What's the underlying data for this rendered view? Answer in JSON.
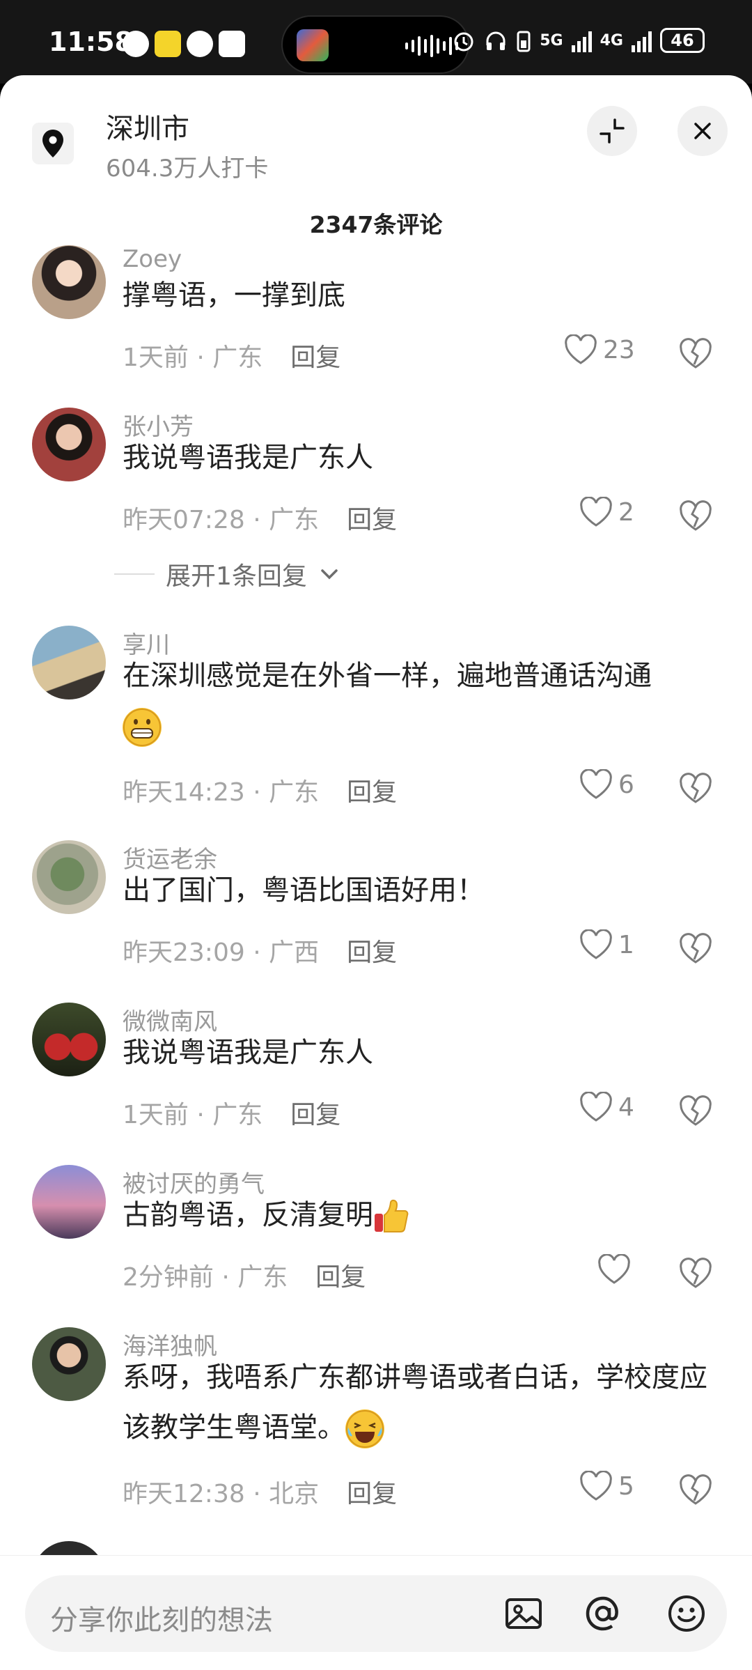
{
  "status_bar": {
    "time": "11:58",
    "battery": "46",
    "net1": "5G",
    "net2": "4G"
  },
  "location": {
    "title": "深圳市",
    "subtitle": "604.3万人打卡"
  },
  "comment_count": "2347条评论",
  "comments": [
    {
      "user": "Zoey",
      "text": "撑粤语，一撑到底",
      "time": "1天前",
      "region": "广东",
      "reply": "回复",
      "likes": "23",
      "avatar_color": "#b9a089"
    },
    {
      "user": "张小芳",
      "text": "我说粤语我是广东人",
      "time": "昨天07:28",
      "region": "广东",
      "reply": "回复",
      "likes": "2",
      "avatar_color": "#a2413d"
    },
    {
      "user": "享川",
      "text": "在深圳感觉是在外省一样，遍地普通话沟通",
      "time": "昨天14:23",
      "region": "广东",
      "reply": "回复",
      "likes": "6",
      "avatar_color": "#8ab0c9"
    },
    {
      "user": "货运老余",
      "text": "出了国门，粤语比国语好用！",
      "time": "昨天23:09",
      "region": "广西",
      "reply": "回复",
      "likes": "1",
      "avatar_color": "#6f8a5e"
    },
    {
      "user": "微微南风",
      "text": "我说粤语我是广东人",
      "time": "1天前",
      "region": "广东",
      "reply": "回复",
      "likes": "4",
      "avatar_color": "#c42a2a"
    },
    {
      "user": "被讨厌的勇气",
      "text": "古韵粤语，反清复明",
      "time": "2分钟前",
      "region": "广东",
      "reply": "回复",
      "likes": "",
      "avatar_color": "#d68fae"
    },
    {
      "user": "海洋独帆",
      "text": "系呀，我唔系广东都讲粤语或者白话，学校度应该教学生粤语堂。",
      "time": "昨天12:38",
      "region": "北京",
      "reply": "回复",
      "likes": "5",
      "avatar_color": "#4d5a43"
    }
  ],
  "expand_replies": "展开1条回复",
  "input": {
    "placeholder": "分享你此刻的想法"
  },
  "icons": [
    "location-pin-icon",
    "collapse-icon",
    "close-icon",
    "heart-icon",
    "broken-heart-icon",
    "image-icon",
    "at-icon",
    "emoji-icon"
  ]
}
